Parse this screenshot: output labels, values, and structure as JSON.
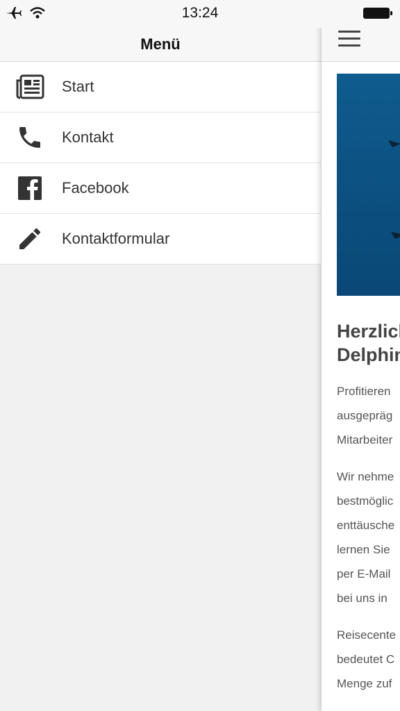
{
  "status_bar": {
    "time": "13:24",
    "icons": [
      "airplane-icon",
      "wifi-icon",
      "battery-icon"
    ]
  },
  "menu": {
    "title": "Menü",
    "items": [
      {
        "label": "Start",
        "icon": "newspaper-icon"
      },
      {
        "label": "Kontakt",
        "icon": "phone-icon"
      },
      {
        "label": "Facebook",
        "icon": "facebook-icon"
      },
      {
        "label": "Kontaktformular",
        "icon": "pencil-icon"
      }
    ]
  },
  "content": {
    "heading": [
      "Herzlich",
      "Delphin"
    ],
    "paragraphs": [
      [
        "Profitieren",
        "ausgepräg",
        "Mitarbeiter"
      ],
      [
        "Wir nehme",
        "bestmöglic",
        "enttäusche",
        "lernen Sie",
        "per E-Mail",
        "bei uns in"
      ],
      [
        "Reisecente",
        "bedeutet C",
        "Menge zuf"
      ]
    ]
  },
  "colors": {
    "hero_blue": "#0b5283",
    "menu_bg": "#f1f1f1"
  }
}
